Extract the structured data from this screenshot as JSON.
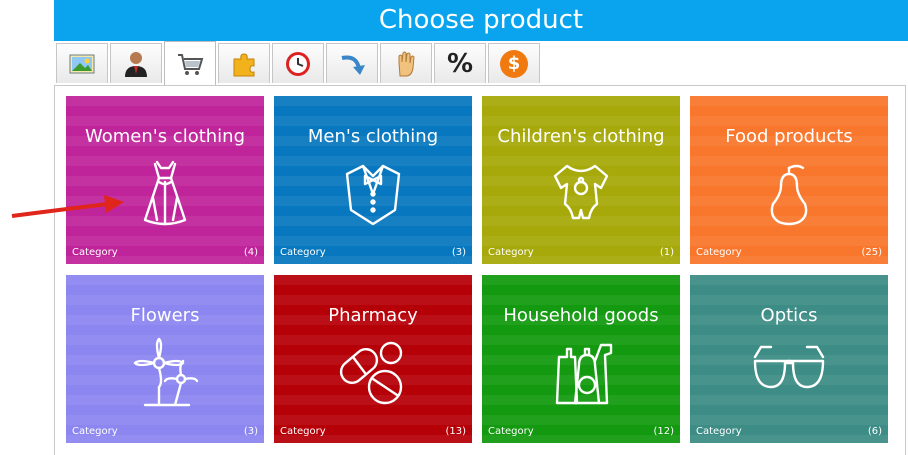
{
  "header": {
    "title": "Choose product"
  },
  "tabs": [
    {
      "icon": "picture-icon"
    },
    {
      "icon": "user-icon"
    },
    {
      "icon": "cart-icon",
      "active": true
    },
    {
      "icon": "puzzle-icon"
    },
    {
      "icon": "clock-icon"
    },
    {
      "icon": "return-arrow-icon"
    },
    {
      "icon": "hand-icon"
    },
    {
      "icon": "percent-icon",
      "glyph": "%"
    },
    {
      "icon": "dollar-icon",
      "glyph": "$"
    }
  ],
  "tiles": [
    {
      "title": "Women's clothing",
      "category": "Category",
      "count": "(4)",
      "color": "#c0249a",
      "icon": "dress-icon"
    },
    {
      "title": "Men's clothing",
      "category": "Category",
      "count": "(3)",
      "color": "#0778bf",
      "icon": "tuxedo-icon"
    },
    {
      "title": "Children's clothing",
      "category": "Category",
      "count": "(1)",
      "color": "#a7a90a",
      "icon": "baby-clothes-icon"
    },
    {
      "title": "Food products",
      "category": "Category",
      "count": "(25)",
      "color": "#f9772d",
      "icon": "pear-icon"
    },
    {
      "title": "Flowers",
      "category": "Category",
      "count": "(3)",
      "color": "#8c86f0",
      "icon": "flower-icon"
    },
    {
      "title": "Pharmacy",
      "category": "Category",
      "count": "(13)",
      "color": "#b60008",
      "icon": "pills-icon"
    },
    {
      "title": "Household goods",
      "category": "Category",
      "count": "(12)",
      "color": "#139a10",
      "icon": "detergents-icon"
    },
    {
      "title": "Optics",
      "category": "Category",
      "count": "(6)",
      "color": "#3d8d86",
      "icon": "glasses-icon"
    }
  ]
}
